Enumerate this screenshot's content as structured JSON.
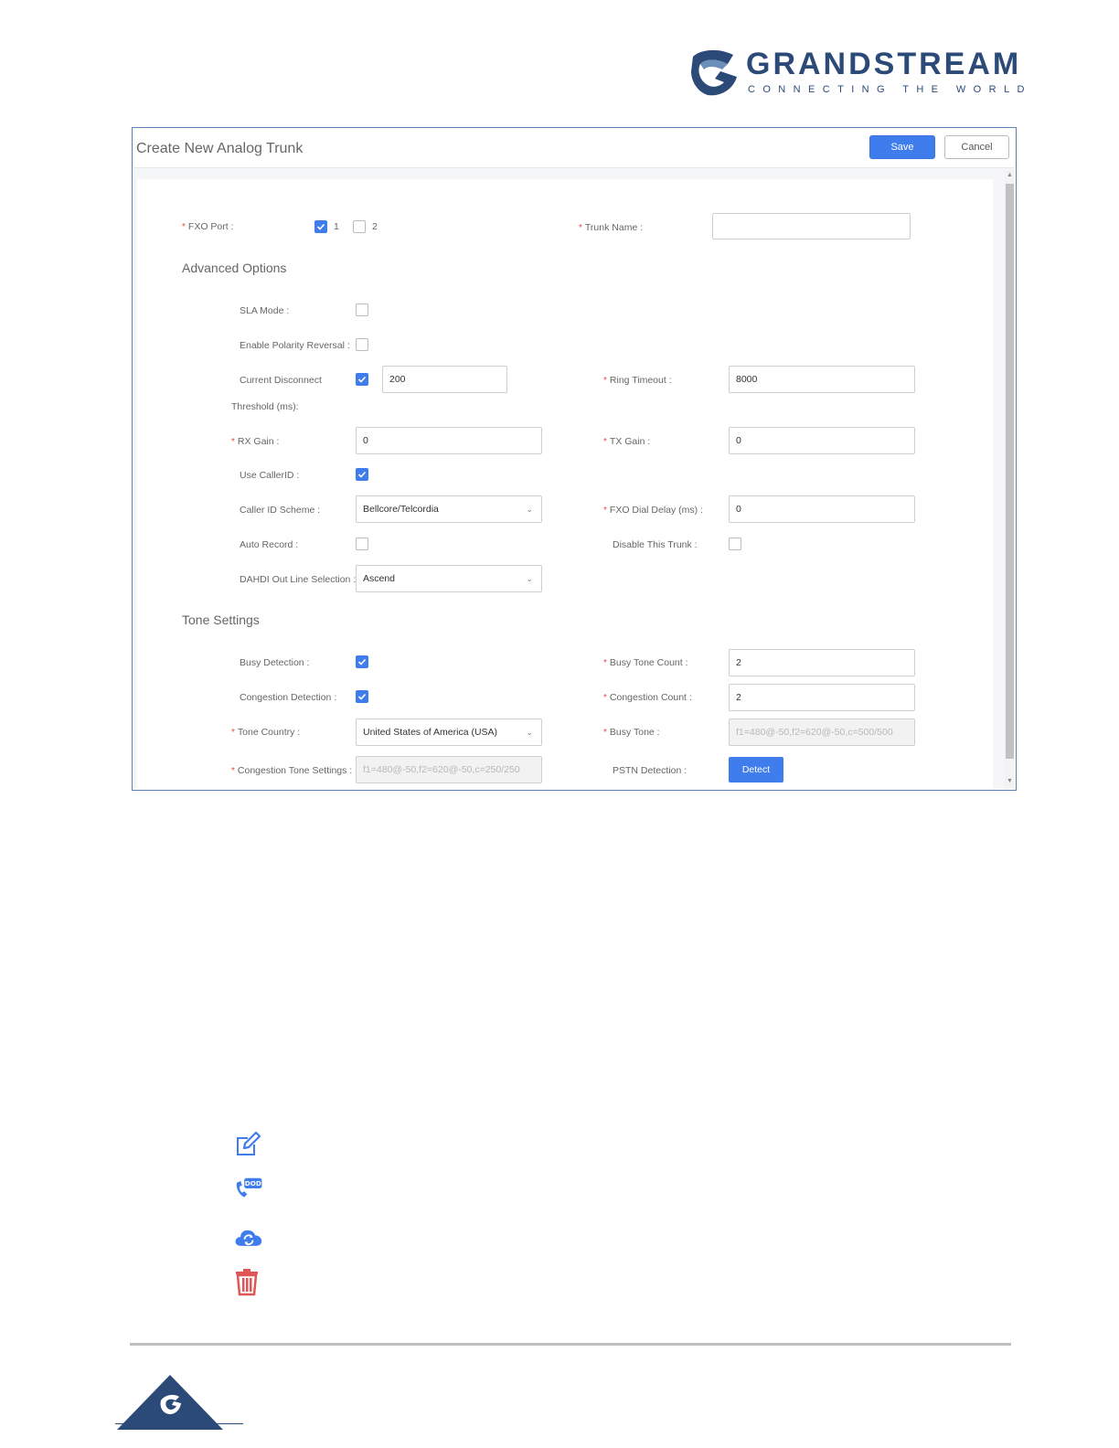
{
  "brand": {
    "name": "GRANDSTREAM",
    "tagline": "CONNECTING THE WORLD"
  },
  "dialog": {
    "title": "Create New Analog Trunk",
    "save_label": "Save",
    "cancel_label": "Cancel",
    "fxo_port": {
      "label": "FXO Port :",
      "options": [
        {
          "label": "1",
          "checked": true
        },
        {
          "label": "2",
          "checked": false
        }
      ]
    },
    "trunk_name": {
      "label": "Trunk Name :",
      "value": ""
    },
    "advanced_title": "Advanced Options",
    "sla_mode": {
      "label": "SLA Mode :",
      "checked": false
    },
    "polarity_reversal": {
      "label": "Enable Polarity Reversal :",
      "checked": false
    },
    "current_disconnect": {
      "label_line1": "Current Disconnect",
      "label_line2": "Threshold (ms):",
      "checked": true,
      "value": "200"
    },
    "ring_timeout": {
      "label": "Ring Timeout :",
      "value": "8000"
    },
    "rx_gain": {
      "label": "RX Gain :",
      "value": "0"
    },
    "tx_gain": {
      "label": "TX Gain :",
      "value": "0"
    },
    "use_callerid": {
      "label": "Use CallerID :",
      "checked": true
    },
    "caller_id_scheme": {
      "label": "Caller ID Scheme :",
      "value": "Bellcore/Telcordia"
    },
    "fxo_dial_delay": {
      "label": "FXO Dial Delay (ms) :",
      "value": "0"
    },
    "auto_record": {
      "label": "Auto Record :",
      "checked": false
    },
    "disable_trunk": {
      "label": "Disable This Trunk :",
      "checked": false
    },
    "dahdi_out_line": {
      "label": "DAHDI Out Line Selection :",
      "value": "Ascend"
    },
    "tone_title": "Tone Settings",
    "busy_detection": {
      "label": "Busy Detection :",
      "checked": true
    },
    "busy_tone_count": {
      "label": "Busy Tone Count :",
      "value": "2"
    },
    "congestion_detection": {
      "label": "Congestion Detection :",
      "checked": true
    },
    "congestion_count": {
      "label": "Congestion Count :",
      "value": "2"
    },
    "tone_country": {
      "label": "Tone Country :",
      "value": "United States of America (USA)"
    },
    "busy_tone": {
      "label": "Busy Tone :",
      "value": "f1=480@-50,f2=620@-50,c=500/500"
    },
    "congestion_tone": {
      "label": "Congestion Tone Settings :",
      "value": "f1=480@-50,f2=620@-50,c=250/250"
    },
    "pstn_detection": {
      "label": "PSTN Detection :",
      "button": "Detect"
    }
  },
  "legend_icons": [
    "edit-icon",
    "dod-icon",
    "cloud-sync-icon",
    "delete-icon"
  ],
  "colors": {
    "primary": "#3f7ded",
    "required": "#e84a4a",
    "brand": "#2b4a78",
    "delete": "#e05555"
  }
}
